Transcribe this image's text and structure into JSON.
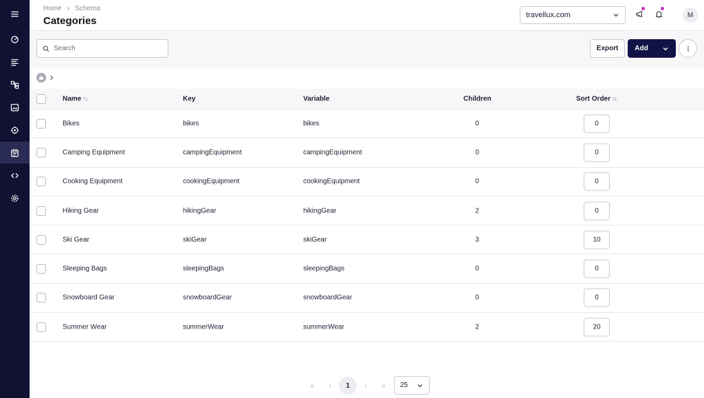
{
  "sidebar": {
    "items": [
      {
        "icon": "menu-icon"
      },
      {
        "icon": "dashboard-icon"
      },
      {
        "icon": "content-icon"
      },
      {
        "icon": "schema-icon"
      },
      {
        "icon": "media-icon"
      },
      {
        "icon": "locations-icon"
      },
      {
        "icon": "categories-icon",
        "active": true
      },
      {
        "icon": "code-icon"
      },
      {
        "icon": "settings-icon"
      }
    ]
  },
  "header": {
    "breadcrumb": [
      "Home",
      "Schema"
    ],
    "title": "Categories",
    "tenant": "travellux.com",
    "avatar_initial": "M",
    "notification_dot_color": "#c62fc8"
  },
  "toolbar": {
    "search_placeholder": "Search",
    "export_label": "Export",
    "add_label": "Add",
    "primary_color": "#111246"
  },
  "table": {
    "columns": {
      "name": "Name",
      "key": "Key",
      "variable": "Variable",
      "children": "Children",
      "sort_order": "Sort Order"
    },
    "rows": [
      {
        "name": "Bikes",
        "key": "bikes",
        "variable": "bikes",
        "children": "0",
        "sort_order": "0"
      },
      {
        "name": "Camping Equipment",
        "key": "campingEquipment",
        "variable": "campingEquipment",
        "children": "0",
        "sort_order": "0"
      },
      {
        "name": "Cooking Equipment",
        "key": "cookingEquipment",
        "variable": "cookingEquipment",
        "children": "0",
        "sort_order": "0"
      },
      {
        "name": "Hiking Gear",
        "key": "hikingGear",
        "variable": "hikingGear",
        "children": "2",
        "sort_order": "0"
      },
      {
        "name": "Ski Gear",
        "key": "skiGear",
        "variable": "skiGear",
        "children": "3",
        "sort_order": "10"
      },
      {
        "name": "Sleeping Bags",
        "key": "sleepingBags",
        "variable": "sleepingBags",
        "children": "0",
        "sort_order": "0"
      },
      {
        "name": "Snowboard Gear",
        "key": "snowboardGear",
        "variable": "snowboardGear",
        "children": "0",
        "sort_order": "0"
      },
      {
        "name": "Summer Wear",
        "key": "summerWear",
        "variable": "summerWear",
        "children": "2",
        "sort_order": "20"
      }
    ]
  },
  "pagination": {
    "current_page": "1",
    "page_size": "25"
  }
}
